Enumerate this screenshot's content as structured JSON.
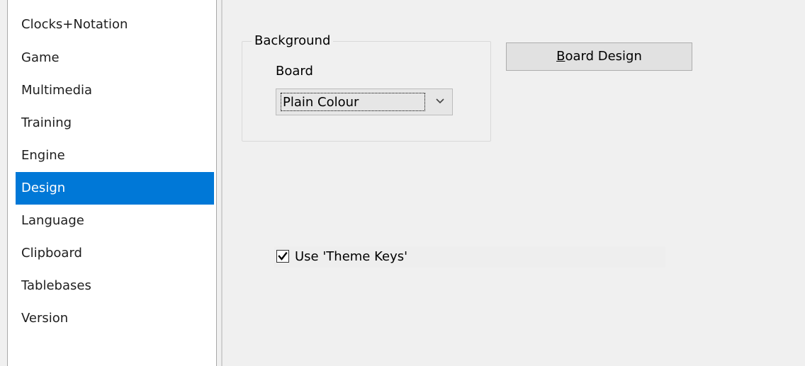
{
  "sidebar": {
    "items": [
      {
        "label": "Clocks+Notation"
      },
      {
        "label": "Game"
      },
      {
        "label": "Multimedia"
      },
      {
        "label": "Training"
      },
      {
        "label": "Engine"
      },
      {
        "label": "Design"
      },
      {
        "label": "Language"
      },
      {
        "label": "Clipboard"
      },
      {
        "label": "Tablebases"
      },
      {
        "label": "Version"
      }
    ],
    "selected": "Design"
  },
  "background_group": {
    "title": "Background",
    "board_label": "Board",
    "board_select": {
      "value": "Plain Colour"
    }
  },
  "board_design_button": {
    "mnemonic": "B",
    "rest": "oard Design"
  },
  "theme_keys": {
    "label": "Use 'Theme Keys'",
    "checked": true
  },
  "colors": {
    "selection": "#0078d7",
    "window_bg": "#f0f0f0"
  },
  "icons": [
    "chevron-down-icon",
    "checkmark-icon"
  ]
}
